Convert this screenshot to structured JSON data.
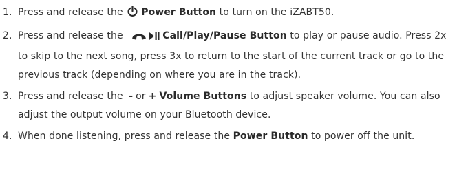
{
  "steps": [
    {
      "num": "1.",
      "pre": "Press and release the ",
      "button": "Power Button",
      "post": " to turn on the iZABT50."
    },
    {
      "num": "2.",
      "pre": "Press and release the ",
      "button": "Call/Play/Pause Button",
      "post": " to play or pause audio. Press 2x to skip to the next song, press 3x to return to the start of the current track or go to the previous track (depending on where you are in the track)."
    },
    {
      "num": "3.",
      "pre": "Press and release the ",
      "minus": "-",
      "or": "or",
      "plus": "+",
      "button": "Volume Buttons",
      "post": " to adjust speaker volume. You can also adjust the output volume on your Bluetooth device."
    },
    {
      "num": "4.",
      "pre": "When done listening, press and release the ",
      "button": "Power Button",
      "post": " to power off the unit."
    }
  ],
  "icons": {
    "power": "power-icon",
    "call": "phone-handset-icon",
    "play_pause": "play-pause-icon"
  },
  "colors": {
    "text": "#333333",
    "bold": "#2a2a2a"
  }
}
